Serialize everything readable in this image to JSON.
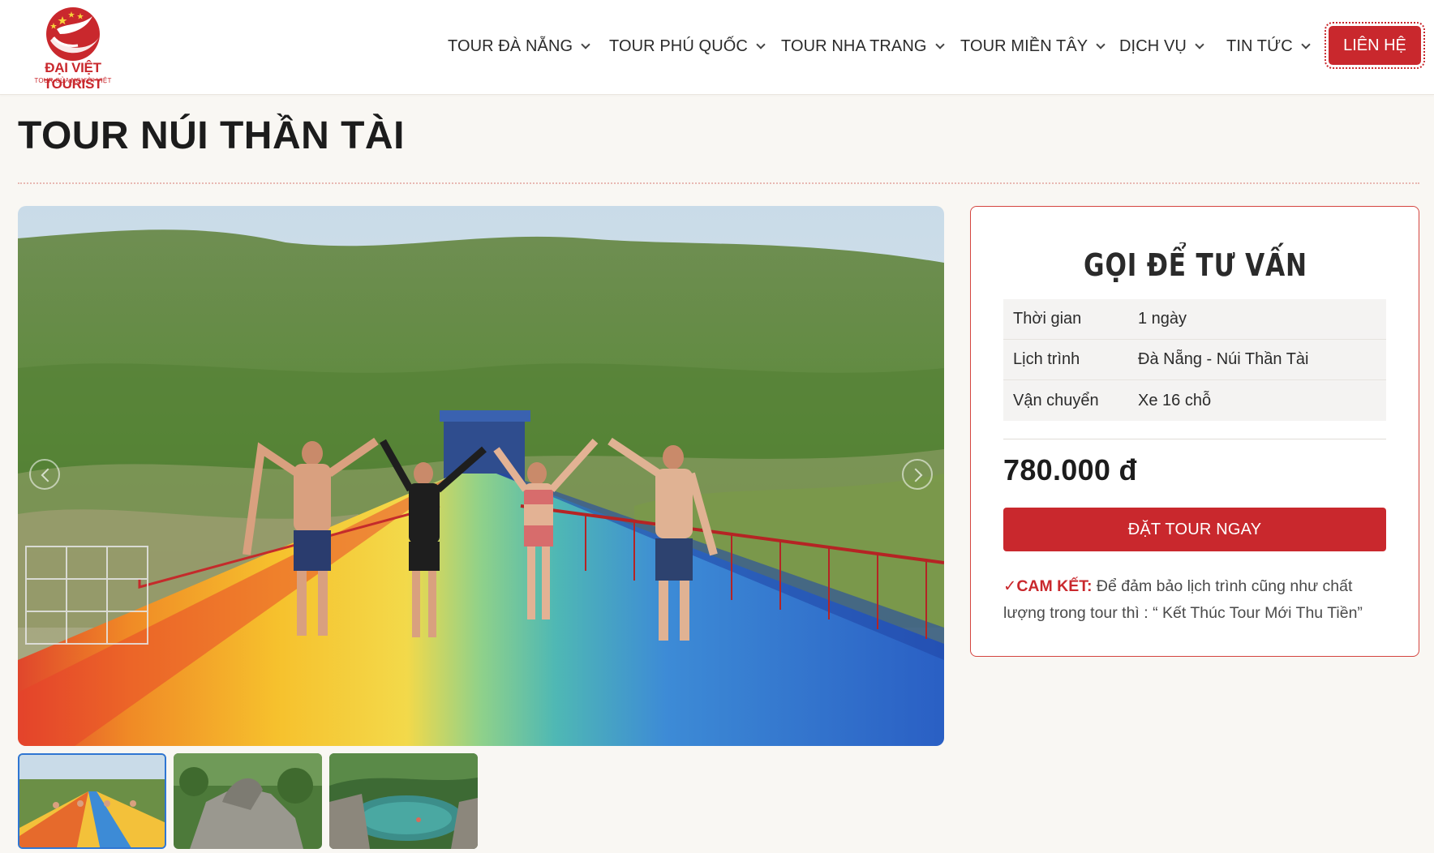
{
  "header": {
    "logo": {
      "brand": "ĐẠI VIỆT TOURIST",
      "slogan": "TOUR CỦA NGƯỜI VIỆT"
    },
    "nav": [
      {
        "label": "TOUR ĐÀ NẴNG"
      },
      {
        "label": "TOUR PHÚ QUỐC"
      },
      {
        "label": "TOUR NHA TRANG"
      },
      {
        "label": "TOUR MIỀN TÂY"
      },
      {
        "label": "DỊCH VỤ"
      },
      {
        "label": "TIN TỨC"
      }
    ],
    "contact_label": "LIÊN HỆ"
  },
  "page": {
    "title": "TOUR NÚI THẦN TÀI"
  },
  "gallery": {
    "thumbnails": [
      {
        "icon": "waterslide-thumbnail"
      },
      {
        "icon": "rock-statue-thumbnail"
      },
      {
        "icon": "hot-spring-pool-thumbnail"
      }
    ]
  },
  "panel": {
    "title": "GỌI ĐỂ TƯ VẤN",
    "rows": [
      {
        "label": "Thời gian",
        "value": "1 ngày"
      },
      {
        "label": "Lịch trình",
        "value": "Đà Nẵng - Núi Thần Tài"
      },
      {
        "label": "Vận chuyển",
        "value": "Xe 16 chỗ"
      }
    ],
    "price": "780.000 đ",
    "book_label": "ĐẶT TOUR NGAY",
    "commit": {
      "check": "✓",
      "label": "CAM KẾT:",
      "text": " Để đảm bảo lịch trình cũng như chất lượng trong tour thì : “ Kết Thúc Tour Mới Thu Tiền”"
    }
  },
  "colors": {
    "accent": "#c9282d",
    "background": "#f9f7f3",
    "panel_border": "#d4453f"
  }
}
